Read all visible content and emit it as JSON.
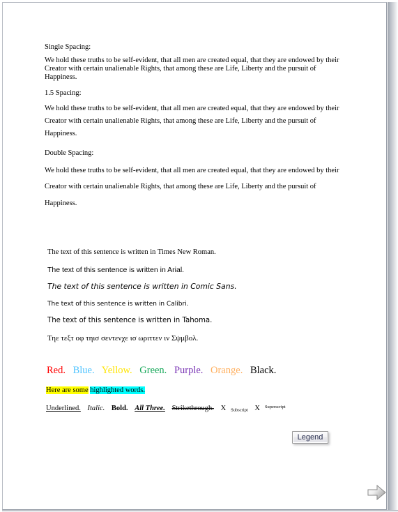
{
  "document": {
    "spacing_sections": [
      {
        "heading": "Single Spacing:",
        "body": "We hold these truths to be self-evident, that all men are created equal, that they are endowed by their Creator with certain unalienable Rights, that among these are Life, Liberty and the pursuit of Happiness.",
        "spacing": "single"
      },
      {
        "heading": "1.5 Spacing:",
        "body": "We hold these truths to be self-evident, that all men are created equal, that they are endowed by their Creator with certain unalienable Rights, that among these are Life, Liberty and the pursuit of Happiness.",
        "spacing": "1.5"
      },
      {
        "heading": "Double Spacing:",
        "body": "We hold these truths to be self-evident, that all men are created equal, that they are endowed by their Creator with certain unalienable Rights, that among these are Life, Liberty and the pursuit of Happiness.",
        "spacing": "double"
      }
    ],
    "font_samples": [
      {
        "font": "Times New Roman",
        "text": "The text of this sentence is written in Times New Roman."
      },
      {
        "font": "Arial",
        "text": "The text of this sentence is written in Arial."
      },
      {
        "font": "Comic Sans",
        "text": "The text of this sentence is written in Comic Sans."
      },
      {
        "font": "Calibri",
        "text": "The text of this sentence is written in Calibri."
      },
      {
        "font": "Tahoma",
        "text": "The text of this sentence is written in Tahoma."
      },
      {
        "font": "Symbol",
        "text": "Τηε τεξτ οφ τηισ σεντενχε ισ ωριττεν ιν Σψμβολ."
      }
    ],
    "color_words": [
      {
        "label": "Red.",
        "color": "#ff0000"
      },
      {
        "label": "Blue.",
        "color": "#4dc3ff"
      },
      {
        "label": "Yellow.",
        "color": "#ffe400"
      },
      {
        "label": "Green.",
        "color": "#17a85a"
      },
      {
        "label": "Purple.",
        "color": "#7a35b5"
      },
      {
        "label": "Orange.",
        "color": "#ffb060"
      },
      {
        "label": "Black.",
        "color": "#000000"
      }
    ],
    "highlight_line": {
      "yellow_text": "Here are some",
      "yellow_color": "#ffff00",
      "cyan_text": "highlighted words.",
      "cyan_color": "#00ffff"
    },
    "format_samples": {
      "underlined": "Underlined.",
      "italic": "Italic.",
      "bold": "Bold.",
      "all_three": "All Three.",
      "strikethrough": "Strikethrough.",
      "subscript_base": "X",
      "subscript_text": "Subscript",
      "superscript_base": "X",
      "superscript_text": "Superscript"
    }
  },
  "controls": {
    "legend_button_label": "Legend",
    "next_arrow_icon": "arrow-right-icon"
  },
  "theme": {
    "page_background": "#ffffff",
    "page_border": "#9aa0aa",
    "text_color": "#000000",
    "button_text_color": "#2a3050",
    "arrow_fill_light": "#ffffff",
    "arrow_fill_dark": "#b0b0b0",
    "arrow_stroke": "#8a8a8a"
  }
}
